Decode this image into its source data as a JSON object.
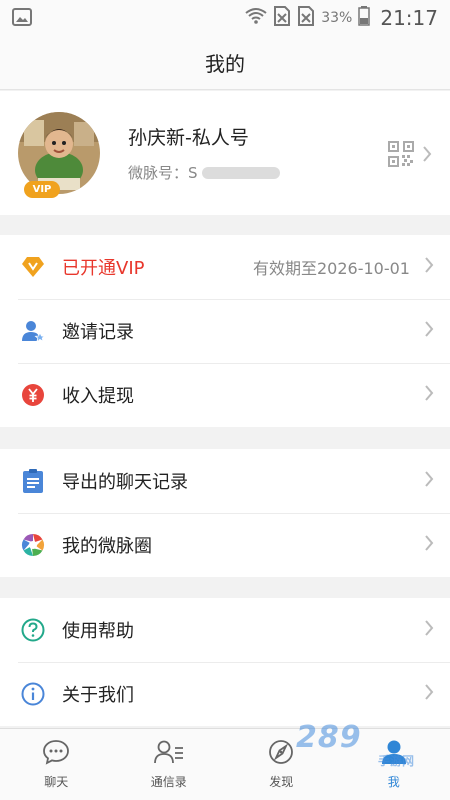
{
  "status_bar": {
    "battery_percent": "33%",
    "time": "21:17",
    "icons": [
      "image-icon",
      "wifi-icon",
      "no-sim-icon",
      "no-sim-icon",
      "battery-icon"
    ]
  },
  "header": {
    "title": "我的"
  },
  "profile": {
    "name": "孙庆新-私人号",
    "id_label": "微脉号：",
    "id_value": "S",
    "badge": "VIP",
    "actions": [
      "qr-code-icon",
      "chevron-right-icon"
    ]
  },
  "menu": {
    "section1": [
      {
        "icon": "vip-diamond-icon",
        "label": "已开通VIP",
        "extra": "有效期至2026-10-01",
        "color": "#e8372c"
      },
      {
        "icon": "invite-user-icon",
        "label": "邀请记录"
      },
      {
        "icon": "yen-coin-icon",
        "label": "收入提现"
      }
    ],
    "section2": [
      {
        "icon": "clipboard-icon",
        "label": "导出的聊天记录"
      },
      {
        "icon": "aperture-icon",
        "label": "我的微脉圈"
      }
    ],
    "section3": [
      {
        "icon": "help-circle-icon",
        "label": "使用帮助"
      },
      {
        "icon": "info-circle-icon",
        "label": "关于我们"
      }
    ]
  },
  "tab_bar": {
    "tabs": [
      {
        "icon": "chat-bubble-icon",
        "label": "聊天"
      },
      {
        "icon": "contacts-icon",
        "label": "通信录"
      },
      {
        "icon": "compass-icon",
        "label": "发现"
      },
      {
        "icon": "user-icon",
        "label": "我",
        "active": true
      }
    ]
  },
  "colors": {
    "accent_blue": "#2f86d6",
    "vip_red": "#e8372c",
    "vip_gold": "#f0a21e"
  },
  "watermark": {
    "text": "289",
    "sub": "手游网"
  }
}
